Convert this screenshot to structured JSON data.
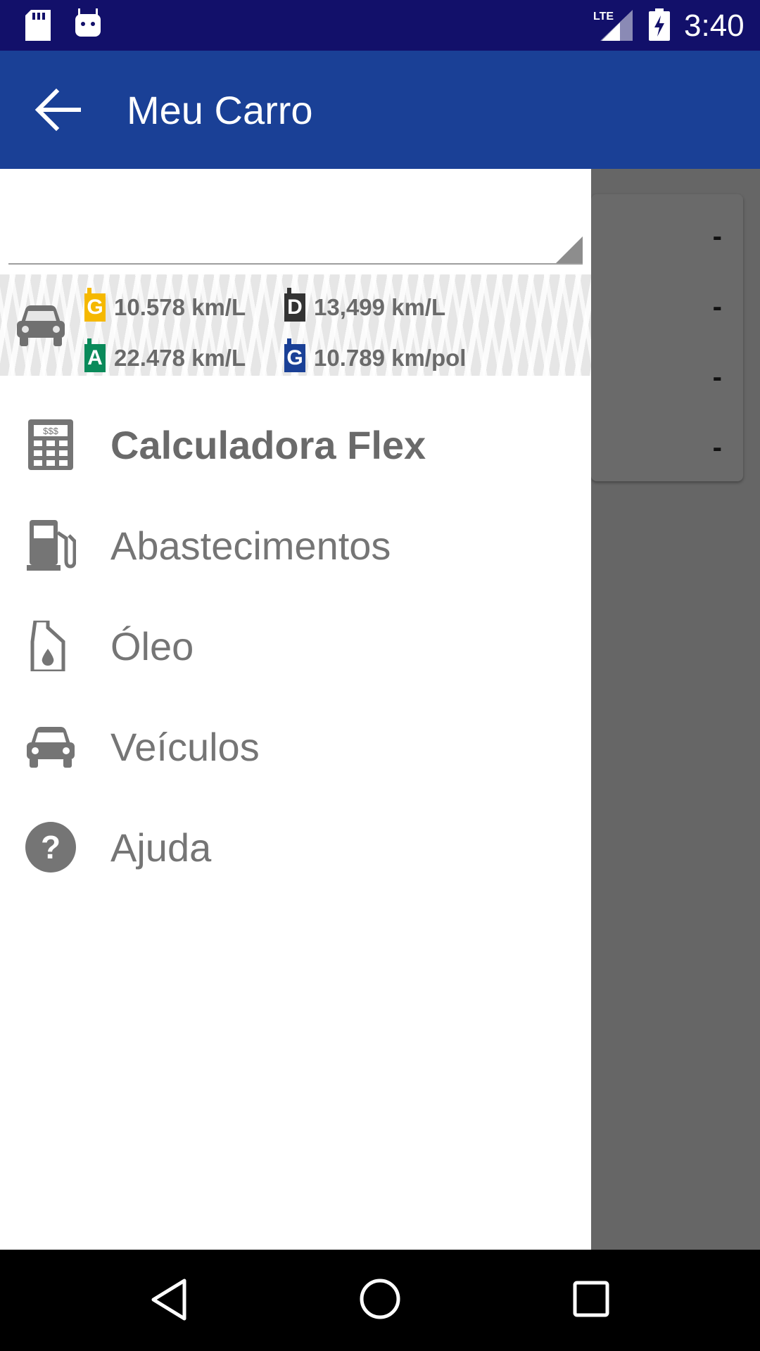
{
  "status_bar": {
    "time": "3:40",
    "network": "LTE",
    "icons": [
      "sd-card-icon",
      "android-icon",
      "lte-signal-icon",
      "battery-charging-icon"
    ]
  },
  "app_bar": {
    "title": "Meu Carro",
    "back_icon": "arrow-back-icon",
    "color": "#1a4096"
  },
  "drawer": {
    "vehicle_select": {
      "value": ""
    },
    "stats": [
      {
        "badge": "G",
        "badge_color": "#f5b800",
        "value": "10.578 km/L"
      },
      {
        "badge": "D",
        "badge_color": "#333333",
        "value": "13,499 km/L"
      },
      {
        "badge": "A",
        "badge_color": "#0a8a5a",
        "value": "22.478 km/L"
      },
      {
        "badge": "G",
        "badge_color": "#1a4096",
        "value": "10.789 km/pol"
      }
    ],
    "menu": [
      {
        "label": "Calculadora Flex",
        "icon": "calculator-icon",
        "active": true
      },
      {
        "label": "Abastecimentos",
        "icon": "fuel-pump-icon",
        "active": false
      },
      {
        "label": "Óleo",
        "icon": "oil-can-icon",
        "active": false
      },
      {
        "label": "Veículos",
        "icon": "car-icon",
        "active": false
      },
      {
        "label": "Ajuda",
        "icon": "help-icon",
        "active": false
      }
    ]
  },
  "background_card": {
    "values": [
      "-",
      "-",
      "-",
      "-"
    ]
  },
  "nav_bar": {
    "buttons": [
      "back-nav-icon",
      "home-nav-icon",
      "recents-nav-icon"
    ]
  }
}
